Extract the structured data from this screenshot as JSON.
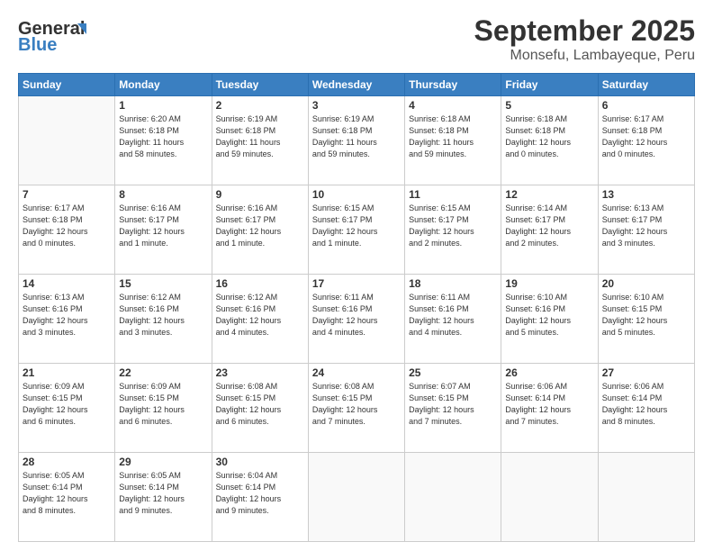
{
  "logo": {
    "line1": "General",
    "line2": "Blue"
  },
  "title": "September 2025",
  "subtitle": "Monsefu, Lambayeque, Peru",
  "weekdays": [
    "Sunday",
    "Monday",
    "Tuesday",
    "Wednesday",
    "Thursday",
    "Friday",
    "Saturday"
  ],
  "weeks": [
    [
      {
        "day": "",
        "info": ""
      },
      {
        "day": "1",
        "info": "Sunrise: 6:20 AM\nSunset: 6:18 PM\nDaylight: 11 hours\nand 58 minutes."
      },
      {
        "day": "2",
        "info": "Sunrise: 6:19 AM\nSunset: 6:18 PM\nDaylight: 11 hours\nand 59 minutes."
      },
      {
        "day": "3",
        "info": "Sunrise: 6:19 AM\nSunset: 6:18 PM\nDaylight: 11 hours\nand 59 minutes."
      },
      {
        "day": "4",
        "info": "Sunrise: 6:18 AM\nSunset: 6:18 PM\nDaylight: 11 hours\nand 59 minutes."
      },
      {
        "day": "5",
        "info": "Sunrise: 6:18 AM\nSunset: 6:18 PM\nDaylight: 12 hours\nand 0 minutes."
      },
      {
        "day": "6",
        "info": "Sunrise: 6:17 AM\nSunset: 6:18 PM\nDaylight: 12 hours\nand 0 minutes."
      }
    ],
    [
      {
        "day": "7",
        "info": "Sunrise: 6:17 AM\nSunset: 6:18 PM\nDaylight: 12 hours\nand 0 minutes."
      },
      {
        "day": "8",
        "info": "Sunrise: 6:16 AM\nSunset: 6:17 PM\nDaylight: 12 hours\nand 1 minute."
      },
      {
        "day": "9",
        "info": "Sunrise: 6:16 AM\nSunset: 6:17 PM\nDaylight: 12 hours\nand 1 minute."
      },
      {
        "day": "10",
        "info": "Sunrise: 6:15 AM\nSunset: 6:17 PM\nDaylight: 12 hours\nand 1 minute."
      },
      {
        "day": "11",
        "info": "Sunrise: 6:15 AM\nSunset: 6:17 PM\nDaylight: 12 hours\nand 2 minutes."
      },
      {
        "day": "12",
        "info": "Sunrise: 6:14 AM\nSunset: 6:17 PM\nDaylight: 12 hours\nand 2 minutes."
      },
      {
        "day": "13",
        "info": "Sunrise: 6:13 AM\nSunset: 6:17 PM\nDaylight: 12 hours\nand 3 minutes."
      }
    ],
    [
      {
        "day": "14",
        "info": "Sunrise: 6:13 AM\nSunset: 6:16 PM\nDaylight: 12 hours\nand 3 minutes."
      },
      {
        "day": "15",
        "info": "Sunrise: 6:12 AM\nSunset: 6:16 PM\nDaylight: 12 hours\nand 3 minutes."
      },
      {
        "day": "16",
        "info": "Sunrise: 6:12 AM\nSunset: 6:16 PM\nDaylight: 12 hours\nand 4 minutes."
      },
      {
        "day": "17",
        "info": "Sunrise: 6:11 AM\nSunset: 6:16 PM\nDaylight: 12 hours\nand 4 minutes."
      },
      {
        "day": "18",
        "info": "Sunrise: 6:11 AM\nSunset: 6:16 PM\nDaylight: 12 hours\nand 4 minutes."
      },
      {
        "day": "19",
        "info": "Sunrise: 6:10 AM\nSunset: 6:16 PM\nDaylight: 12 hours\nand 5 minutes."
      },
      {
        "day": "20",
        "info": "Sunrise: 6:10 AM\nSunset: 6:15 PM\nDaylight: 12 hours\nand 5 minutes."
      }
    ],
    [
      {
        "day": "21",
        "info": "Sunrise: 6:09 AM\nSunset: 6:15 PM\nDaylight: 12 hours\nand 6 minutes."
      },
      {
        "day": "22",
        "info": "Sunrise: 6:09 AM\nSunset: 6:15 PM\nDaylight: 12 hours\nand 6 minutes."
      },
      {
        "day": "23",
        "info": "Sunrise: 6:08 AM\nSunset: 6:15 PM\nDaylight: 12 hours\nand 6 minutes."
      },
      {
        "day": "24",
        "info": "Sunrise: 6:08 AM\nSunset: 6:15 PM\nDaylight: 12 hours\nand 7 minutes."
      },
      {
        "day": "25",
        "info": "Sunrise: 6:07 AM\nSunset: 6:15 PM\nDaylight: 12 hours\nand 7 minutes."
      },
      {
        "day": "26",
        "info": "Sunrise: 6:06 AM\nSunset: 6:14 PM\nDaylight: 12 hours\nand 7 minutes."
      },
      {
        "day": "27",
        "info": "Sunrise: 6:06 AM\nSunset: 6:14 PM\nDaylight: 12 hours\nand 8 minutes."
      }
    ],
    [
      {
        "day": "28",
        "info": "Sunrise: 6:05 AM\nSunset: 6:14 PM\nDaylight: 12 hours\nand 8 minutes."
      },
      {
        "day": "29",
        "info": "Sunrise: 6:05 AM\nSunset: 6:14 PM\nDaylight: 12 hours\nand 9 minutes."
      },
      {
        "day": "30",
        "info": "Sunrise: 6:04 AM\nSunset: 6:14 PM\nDaylight: 12 hours\nand 9 minutes."
      },
      {
        "day": "",
        "info": ""
      },
      {
        "day": "",
        "info": ""
      },
      {
        "day": "",
        "info": ""
      },
      {
        "day": "",
        "info": ""
      }
    ]
  ]
}
